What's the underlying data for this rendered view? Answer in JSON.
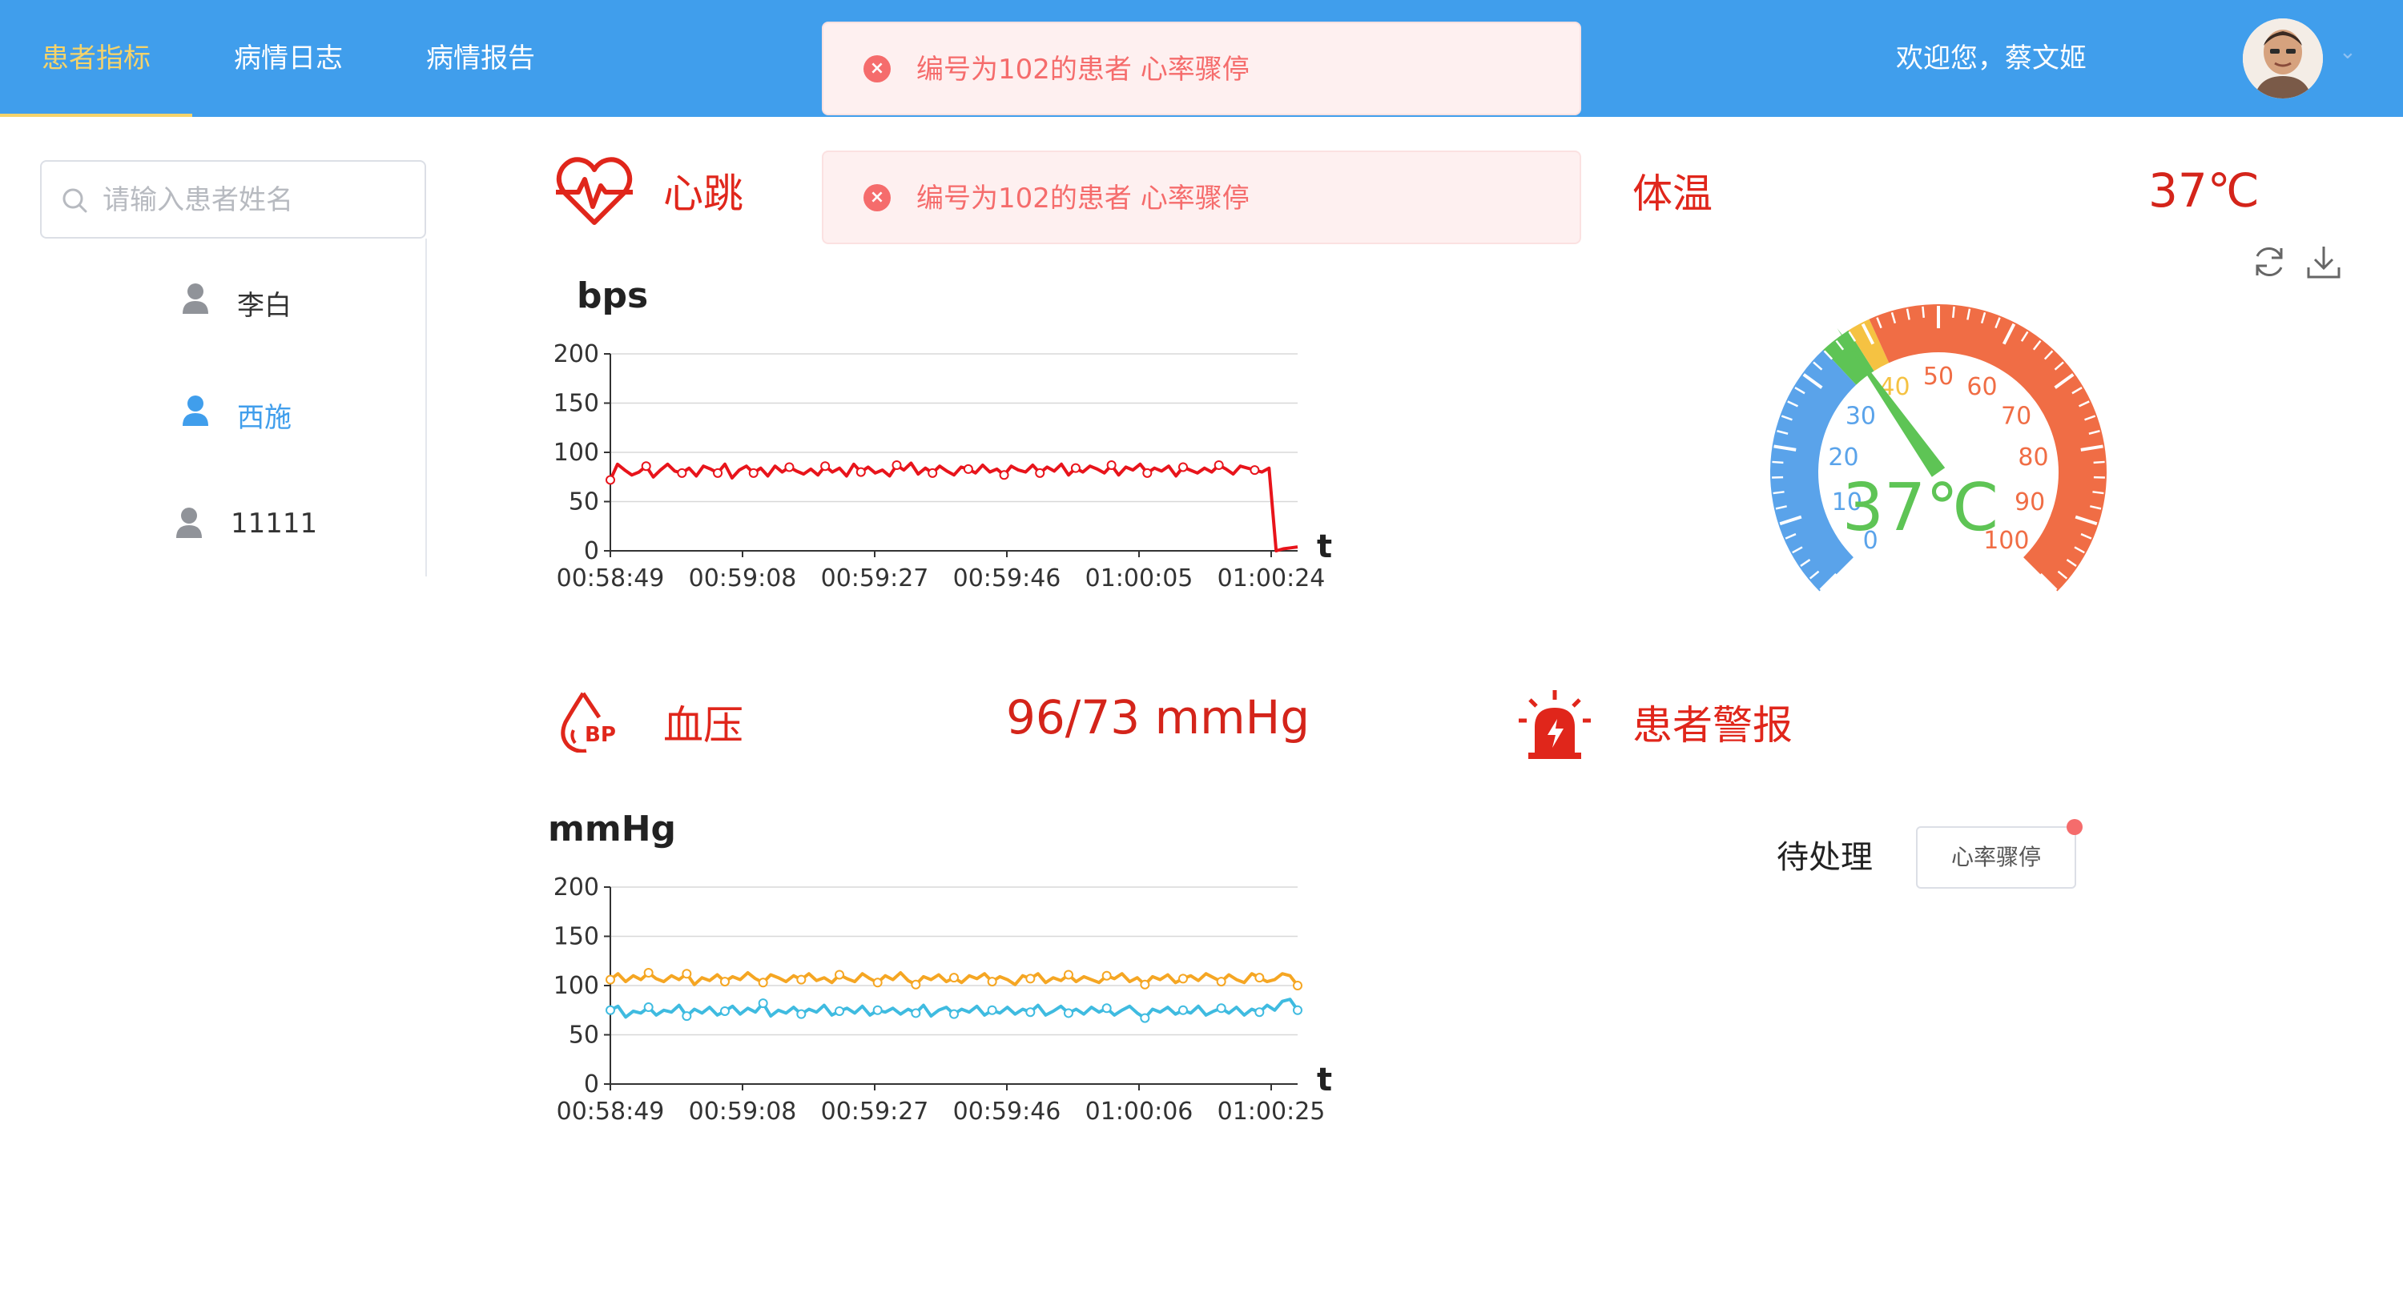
{
  "header": {
    "nav": [
      "患者指标",
      "病情日志",
      "病情报告"
    ],
    "active_index": 0,
    "welcome": "欢迎您，蔡文姬"
  },
  "alerts": [
    {
      "text": "编号为102的患者 心率骤停"
    },
    {
      "text": "编号为102的患者 心率骤停"
    }
  ],
  "sidebar": {
    "search_placeholder": "请输入患者姓名",
    "patients": [
      {
        "name": "李白",
        "active": false
      },
      {
        "name": "西施",
        "active": true
      },
      {
        "name": "11111",
        "active": false
      }
    ]
  },
  "heartbeat": {
    "title": "心跳",
    "unit": "bps"
  },
  "temperature": {
    "title": "体温",
    "value": "37℃",
    "gauge_label": "37℃",
    "gauge_value": 37,
    "gauge_ticks": [
      "0",
      "10",
      "20",
      "30",
      "40",
      "50",
      "60",
      "70",
      "80",
      "90",
      "100"
    ]
  },
  "blood_pressure": {
    "title": "血压",
    "value": "96/73 mmHg",
    "unit": "mmHg"
  },
  "alarm": {
    "title": "患者警报",
    "pending_label": "待处理",
    "items": [
      "心率骤停"
    ]
  },
  "colors": {
    "header": "#409eec",
    "accent": "#f5d36a",
    "alert_red": "#e0261b",
    "heart_line": "#e8141b",
    "systolic": "#f5a623",
    "diastolic": "#3fbbe0",
    "gauge_blue": "#5aa3ea",
    "gauge_orange": "#f06d45",
    "gauge_needle": "#5ec455"
  },
  "chart_data": [
    {
      "type": "line",
      "title": "",
      "ylabel": "bps",
      "xlabel": "t",
      "ylim": [
        0,
        200
      ],
      "yticks": [
        0,
        50,
        100,
        150,
        200
      ],
      "x_tick_labels": [
        "00:58:49",
        "00:59:08",
        "00:59:27",
        "00:59:46",
        "01:00:05",
        "01:00:24"
      ],
      "series": [
        {
          "values": [
            72,
            88,
            82,
            77,
            80,
            86,
            75,
            82,
            88,
            81,
            79,
            84,
            76,
            86,
            83,
            79,
            88,
            74,
            82,
            86,
            79,
            84,
            76,
            86,
            80,
            85,
            81,
            78,
            83,
            77,
            86,
            80,
            84,
            76,
            88,
            80,
            85,
            79,
            82,
            76,
            87,
            82,
            89,
            78,
            84,
            79,
            86,
            81,
            77,
            85,
            83,
            79,
            87,
            80,
            83,
            77,
            86,
            82,
            80,
            87,
            79,
            85,
            81,
            88,
            77,
            84,
            80,
            86,
            83,
            79,
            87,
            77,
            85,
            82,
            88,
            79,
            84,
            81,
            86,
            76,
            85,
            82,
            79,
            84,
            80,
            87,
            83,
            78,
            86,
            84,
            82,
            80,
            84,
            0,
            2,
            3,
            4
          ]
        }
      ]
    },
    {
      "type": "line",
      "title": "",
      "ylabel": "mmHg",
      "xlabel": "t",
      "ylim": [
        0,
        200
      ],
      "yticks": [
        0,
        50,
        100,
        150,
        200
      ],
      "x_tick_labels": [
        "00:58:49",
        "00:59:08",
        "00:59:27",
        "00:59:46",
        "01:00:06",
        "01:00:25"
      ],
      "series": [
        {
          "values": [
            106,
            112,
            104,
            110,
            106,
            113,
            107,
            104,
            110,
            106,
            112,
            101,
            108,
            105,
            111,
            104,
            109,
            106,
            113,
            107,
            103,
            111,
            108,
            104,
            110,
            106,
            112,
            105,
            108,
            103,
            111,
            107,
            104,
            112,
            107,
            103,
            110,
            106,
            113,
            105,
            101,
            109,
            106,
            111,
            104,
            108,
            103,
            110,
            107,
            112,
            104,
            109,
            106,
            101,
            110,
            107,
            112,
            103,
            108,
            105,
            111,
            104,
            109,
            106,
            103,
            110,
            107,
            112,
            104,
            108,
            101,
            109,
            106,
            111,
            103,
            107,
            110,
            105,
            112,
            108,
            104,
            111,
            106,
            103,
            112,
            108,
            104,
            106,
            112,
            110,
            100
          ]
        },
        {
          "values": [
            75,
            79,
            68,
            74,
            72,
            78,
            70,
            75,
            73,
            80,
            69,
            76,
            72,
            78,
            70,
            74,
            79,
            71,
            77,
            73,
            82,
            69,
            75,
            72,
            78,
            71,
            76,
            73,
            80,
            70,
            74,
            77,
            72,
            79,
            70,
            75,
            73,
            77,
            71,
            76,
            72,
            80,
            69,
            75,
            78,
            71,
            76,
            73,
            79,
            70,
            75,
            72,
            78,
            71,
            76,
            73,
            80,
            70,
            74,
            79,
            72,
            76,
            71,
            78,
            73,
            77,
            70,
            75,
            79,
            72,
            67,
            76,
            73,
            78,
            71,
            75,
            72,
            79,
            70,
            74,
            77,
            72,
            78,
            70,
            76,
            73,
            80,
            75,
            84,
            86,
            75
          ]
        }
      ]
    }
  ]
}
